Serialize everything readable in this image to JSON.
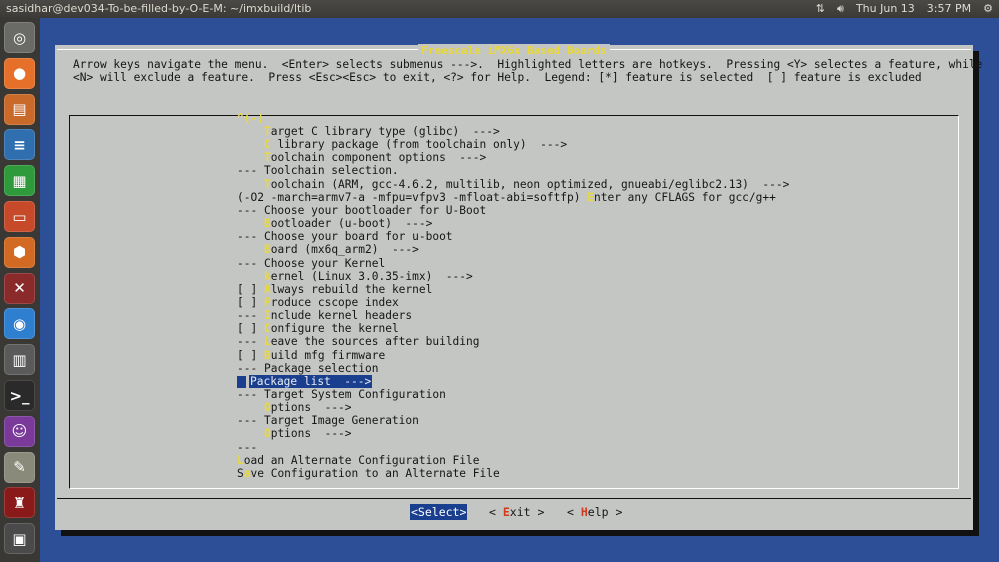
{
  "topbar": {
    "window_title": "sasidhar@dev034-To-be-filled-by-O-E-M: ~/imxbuild/ltib",
    "datetime": "Thu Jun 13",
    "time": "3:57 PM"
  },
  "launcher": {
    "items": [
      {
        "name": "Dash Home",
        "color": "#6a6a66",
        "glyph": "◎"
      },
      {
        "name": "Firefox",
        "color": "#e6702a",
        "glyph": "●"
      },
      {
        "name": "Files",
        "color": "#ca6a2a",
        "glyph": "▤"
      },
      {
        "name": "Writer",
        "color": "#2f6fb0",
        "glyph": "≡"
      },
      {
        "name": "Calc",
        "color": "#2f9a3c",
        "glyph": "▦"
      },
      {
        "name": "Impress",
        "color": "#c64a2a",
        "glyph": "▭"
      },
      {
        "name": "Software Center",
        "color": "#d26a24",
        "glyph": "⬢"
      },
      {
        "name": "System Settings",
        "color": "#8a2a2a",
        "glyph": "✕"
      },
      {
        "name": "Chrome",
        "color": "#2f7fd0",
        "glyph": "◉"
      },
      {
        "name": "Calculator",
        "color": "#5a5a5a",
        "glyph": "▥"
      },
      {
        "name": "Terminal",
        "color": "#2a2a2a",
        "glyph": ">_"
      },
      {
        "name": "Pidgin",
        "color": "#7a3a9a",
        "glyph": "☺"
      },
      {
        "name": "Text Editor",
        "color": "#8a8a7a",
        "glyph": "✎"
      },
      {
        "name": "Wine",
        "color": "#8a1a1a",
        "glyph": "♜"
      },
      {
        "name": "Workspaces",
        "color": "#4a4a4a",
        "glyph": "▣"
      }
    ]
  },
  "dialog": {
    "title": "Freescale iMX6x Based Boards",
    "help_line_1": "Arrow keys navigate the menu.  <Enter> selects submenus --->.  Highlighted letters are hotkeys.  Pressing <Y> selectes a feature, while",
    "help_line_2": "<N> will exclude a feature.  Press <Esc><Esc> to exit, <?> for Help.  Legend: [*] feature is selected  [ ] feature is excluded",
    "scroll_indicator": "^(-)",
    "menu_items": [
      {
        "prefix": "    ",
        "hotkey": "T",
        "rest": "arget C library type (glibc)  --->"
      },
      {
        "prefix": "    ",
        "hotkey": "C",
        "rest": " library package (from toolchain only)  --->"
      },
      {
        "prefix": "    ",
        "hotkey": "T",
        "rest": "oolchain component options  --->"
      },
      {
        "prefix": "--- ",
        "hotkey": "",
        "rest": "Toolchain selection."
      },
      {
        "prefix": "    ",
        "hotkey": "T",
        "rest": "oolchain (ARM, gcc-4.6.2, multilib, neon optimized, gnueabi/eglibc2.13)  --->"
      },
      {
        "prefix": "",
        "hotkey": "",
        "rest": "(-O2 -march=armv7-a -mfpu=vfpv3 -mfloat-abi=softfp) ",
        "hotkey2": "E",
        "rest2": "nter any CFLAGS for gcc/g++"
      },
      {
        "prefix": "--- ",
        "hotkey": "",
        "rest": "Choose your bootloader for U-Boot"
      },
      {
        "prefix": "    ",
        "hotkey": "B",
        "rest": "ootloader (u-boot)  --->"
      },
      {
        "prefix": "--- ",
        "hotkey": "",
        "rest": "Choose your board for u-boot"
      },
      {
        "prefix": "    ",
        "hotkey": "B",
        "rest": "oard (mx6q_arm2)  --->"
      },
      {
        "prefix": "--- ",
        "hotkey": "",
        "rest": "Choose your Kernel"
      },
      {
        "prefix": "    ",
        "hotkey": "k",
        "rest": "ernel (Linux 3.0.35-imx)  --->"
      },
      {
        "prefix": "[ ] ",
        "hotkey": "A",
        "rest": "lways rebuild the kernel"
      },
      {
        "prefix": "[ ] ",
        "hotkey": "P",
        "rest": "roduce cscope index"
      },
      {
        "prefix": "--- ",
        "hotkey": "I",
        "rest": "nclude kernel headers"
      },
      {
        "prefix": "[ ] ",
        "hotkey": "C",
        "rest": "onfigure the kernel"
      },
      {
        "prefix": "--- ",
        "hotkey": "L",
        "rest": "eave the sources after building"
      },
      {
        "prefix": "[ ] ",
        "hotkey": "B",
        "rest": "uild mfg firmware"
      },
      {
        "prefix": "--- ",
        "hotkey": "",
        "rest": "Package selection"
      },
      {
        "prefix": "",
        "hotkey": "",
        "rest": "Package list  --->",
        "selected": true
      },
      {
        "prefix": "--- ",
        "hotkey": "",
        "rest": "Target System Configuration"
      },
      {
        "prefix": "    ",
        "hotkey": "O",
        "rest": "ptions  --->"
      },
      {
        "prefix": "--- ",
        "hotkey": "",
        "rest": "Target Image Generation"
      },
      {
        "prefix": "    ",
        "hotkey": "O",
        "rest": "ptions  --->"
      },
      {
        "prefix": "---",
        "hotkey": "",
        "rest": ""
      },
      {
        "prefix": "",
        "hotkey": "L",
        "rest": "oad an Alternate Configuration File"
      },
      {
        "prefix": "S",
        "hotkey": "a",
        "rest": "ve Configuration to an Alternate File"
      }
    ],
    "buttons": {
      "select": "<Select>",
      "exit_pre": "< ",
      "exit_hot": "E",
      "exit_rest": "xit >",
      "help_pre": "< ",
      "help_hot": "H",
      "help_rest": "elp >"
    }
  }
}
